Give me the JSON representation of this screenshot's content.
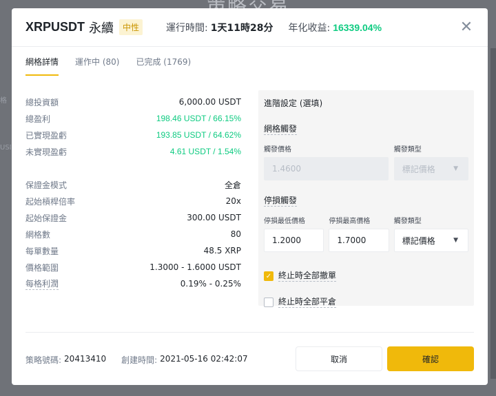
{
  "background": {
    "title": "策略交易",
    "side_text_1": "格",
    "side_text_2": "USD"
  },
  "header": {
    "symbol": "XRPUSDT",
    "contract_type": "永續",
    "mode_badge": "中性",
    "runtime_label": "運行時間:",
    "runtime_value": "1天11時28分",
    "apy_label": "年化收益:",
    "apy_value": "16339.04%"
  },
  "tabs": [
    {
      "label": "網格詳情",
      "active": true
    },
    {
      "label": "運作中 (80)",
      "active": false
    },
    {
      "label": "已完成 (1769)",
      "active": false
    }
  ],
  "summary": [
    {
      "label": "總投資額",
      "value": "6,000.00 USDT"
    },
    {
      "label": "總盈利",
      "value": "198.46 USDT / 66.15%"
    },
    {
      "label": "已實現盈虧",
      "value": "193.85 USDT / 64.62%"
    },
    {
      "label": "未實現盈虧",
      "value": "4.61 USDT / 1.54%"
    }
  ],
  "details": [
    {
      "label": "保證金模式",
      "value": "全倉"
    },
    {
      "label": "起始槓桿倍率",
      "value": "20x"
    },
    {
      "label": "起始保證金",
      "value": "300.00 USDT"
    },
    {
      "label": "網格數",
      "value": "80"
    },
    {
      "label": "每單數量",
      "value": "48.5 XRP"
    },
    {
      "label": "價格範圍",
      "value": "1.3000 - 1.6000 USDT"
    },
    {
      "label": "每格利潤",
      "value": "0.19% - 0.25%"
    }
  ],
  "advanced": {
    "title": "進階設定 (選填)",
    "grid_trigger": {
      "title": "網格觸發",
      "price_label": "觸發價格",
      "price_value": "1.4600",
      "type_label": "觸發類型",
      "type_value": "標記價格"
    },
    "stop_trigger": {
      "title": "停損觸發",
      "low_label": "停損最低價格",
      "low_value": "1.2000",
      "high_label": "停損最高價格",
      "high_value": "1.7000",
      "type_label": "觸發類型",
      "type_value": "標記價格"
    },
    "cancel_all_on_stop": {
      "label": "終止時全部撤單",
      "checked": true
    },
    "close_all_on_stop": {
      "label": "終止時全部平倉",
      "checked": false
    }
  },
  "footer": {
    "strategy_id_label": "策略號碼:",
    "strategy_id": "20413410",
    "created_label": "創建時間:",
    "created_value": "2021-05-16 02:42:07",
    "cancel_label": "取消",
    "confirm_label": "確認"
  },
  "colors": {
    "accent": "#f0b90b",
    "positive": "#0ecb81",
    "badge_bg": "#fcf3d2",
    "badge_text": "#c99400"
  }
}
